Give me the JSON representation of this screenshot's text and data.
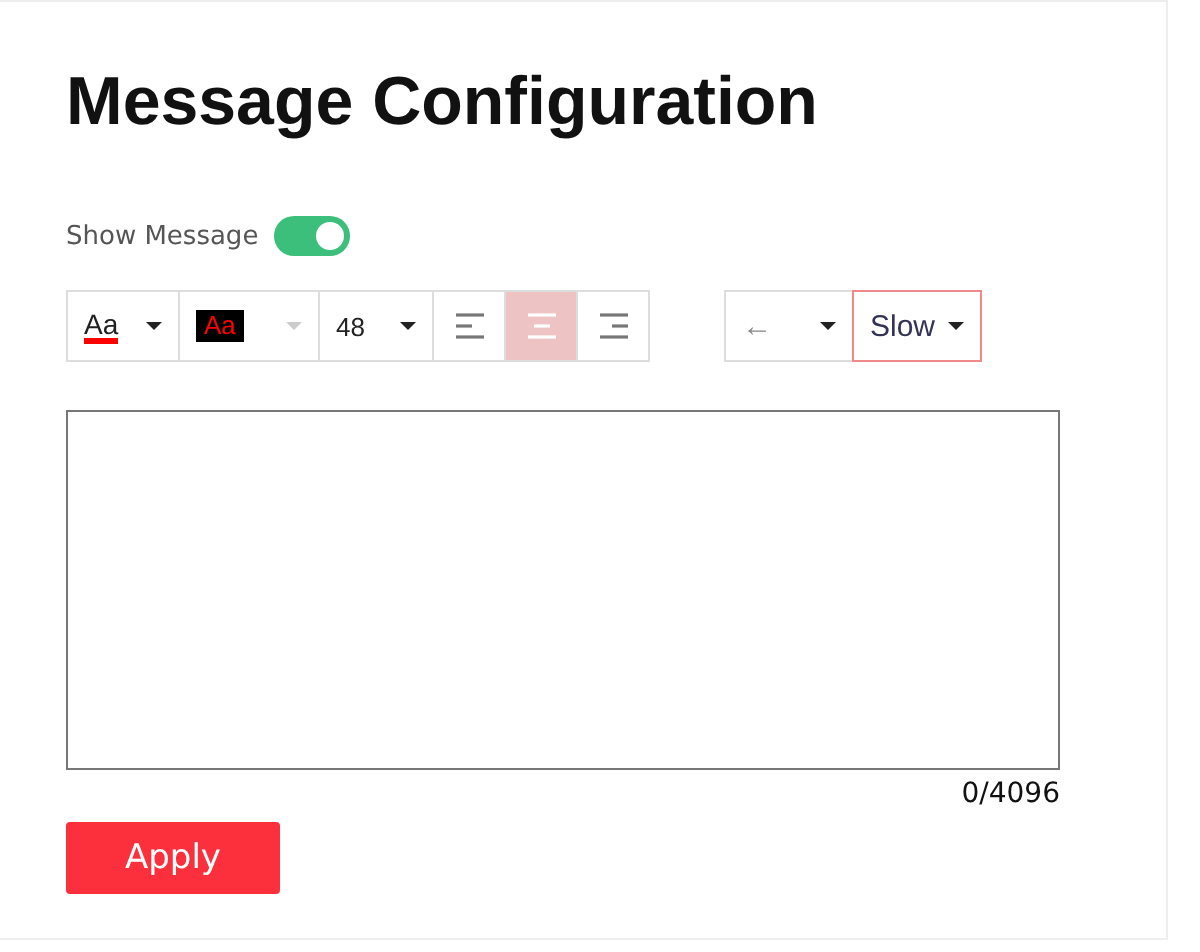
{
  "title": "Message Configuration",
  "show_message": {
    "label": "Show Message",
    "on": true
  },
  "toolbar": {
    "font_color": {
      "text": "Aa",
      "color": "#ff0000"
    },
    "background_color": {
      "text": "Aa",
      "color": "#000000",
      "disabled": true
    },
    "font_size": "48",
    "alignment": [
      {
        "kind": "left",
        "selected": false
      },
      {
        "kind": "center",
        "selected": true
      },
      {
        "kind": "right",
        "selected": false
      }
    ],
    "scroll_direction": "←",
    "speed": {
      "value": "Slow",
      "focused": true
    }
  },
  "message": {
    "counter": "0/4096"
  },
  "apply_button": "Apply"
}
